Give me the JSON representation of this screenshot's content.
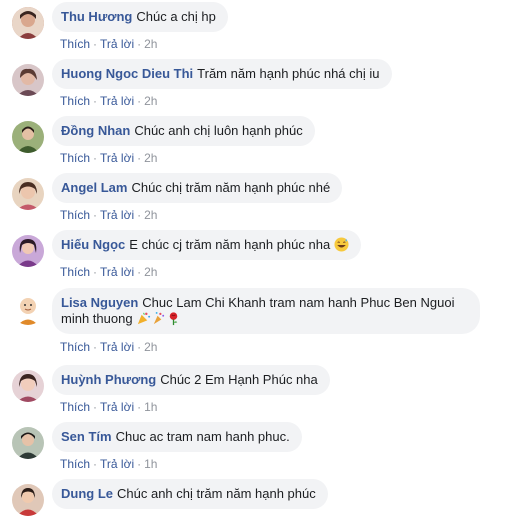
{
  "comments": [
    {
      "author": "Thu Hương",
      "text": "Chúc a chị hp",
      "like": "Thích",
      "reply": "Trả lời",
      "time": "2h",
      "avatar_color": "#c98b7a"
    },
    {
      "author": "Huong Ngoc Dieu Thi",
      "text": "Trăm năm hạnh phúc nhá chị iu",
      "like": "Thích",
      "reply": "Trả lời",
      "time": "2h",
      "avatar_color": "#b07a86"
    },
    {
      "author": "Đồng Nhan",
      "text": "Chúc anh chị luôn hạnh phúc",
      "like": "Thích",
      "reply": "Trả lời",
      "time": "2h",
      "avatar_color": "#6f8a4c"
    },
    {
      "author": "Angel Lam",
      "text": "Chúc chị trăm năm hạnh phúc nhé",
      "like": "Thích",
      "reply": "Trả lời",
      "time": "2h",
      "avatar_color": "#c7a07c"
    },
    {
      "author": "Hiếu Ngọc",
      "text": "E chúc cj trăm năm hạnh phúc nha",
      "emoji": "grinning-sweat-emoji",
      "like": "Thích",
      "reply": "Trả lời",
      "time": "2h",
      "avatar_color": "#9a5fa0"
    },
    {
      "author": "Lisa Nguyen",
      "text": "Chuc Lam Chi Khanh tram nam hanh Phuc Ben Nguoi minh thuong",
      "emojis": [
        "party-popper-emoji",
        "confetti-emoji",
        "rose-emoji"
      ],
      "like": "Thích",
      "reply": "Trả lời",
      "time": "2h",
      "avatar_color": "#e8c2a0"
    },
    {
      "author": "Huỳnh Phương",
      "text": "Chúc 2 Em Hạnh Phúc nha",
      "like": "Thích",
      "reply": "Trả lời",
      "time": "1h",
      "avatar_color": "#c89aa0"
    },
    {
      "author": "Sen Tím",
      "text": "Chuc ac tram nam hanh phuc.",
      "like": "Thích",
      "reply": "Trả lời",
      "time": "1h",
      "avatar_color": "#7d8a7a"
    },
    {
      "author": "Dung Le",
      "text": "Chúc anh chị trăm năm hạnh phúc",
      "avatar_color": "#b04848"
    }
  ]
}
